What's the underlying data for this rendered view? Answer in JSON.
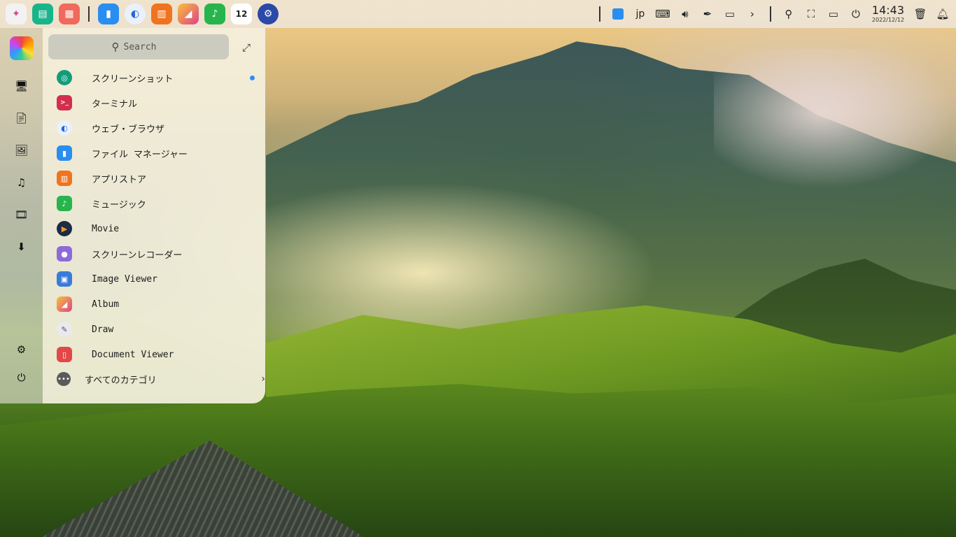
{
  "taskbar": {
    "apps": [
      {
        "name": "launcher-icon",
        "glyph": "✦",
        "color": "#f2f2f2"
      },
      {
        "name": "multitasking-icon",
        "glyph": "▤",
        "color": "#19b58a"
      },
      {
        "name": "app-grid-icon",
        "glyph": "▦",
        "color": "#f06a5b"
      },
      {
        "name": "file-manager-icon",
        "glyph": "▮",
        "color": "#2a8df0"
      },
      {
        "name": "browser-icon",
        "glyph": "◐",
        "color": "#2566d8"
      },
      {
        "name": "app-store-icon",
        "glyph": "▥",
        "color": "#f0731f"
      },
      {
        "name": "album-icon",
        "glyph": "◢",
        "color": "#f0a02e"
      },
      {
        "name": "music-icon",
        "glyph": "♪",
        "color": "#27b44c"
      },
      {
        "name": "calendar-icon",
        "glyph": "12",
        "color": "#ffffff"
      },
      {
        "name": "settings-icon",
        "glyph": "⚙",
        "color": "#2a49a8"
      }
    ],
    "tray": {
      "input_method": "jp",
      "icons": [
        "screenshot-tray-icon",
        "keyboard-icon",
        "volume-icon",
        "pen-icon",
        "battery-icon",
        "expand-arrow-icon",
        "search-icon",
        "screen-capture-icon",
        "display-icon",
        "power-icon"
      ]
    },
    "clock": {
      "time": "14:43",
      "date": "2022/12/12"
    }
  },
  "launcher": {
    "search": {
      "placeholder": "Search"
    },
    "apps": [
      {
        "label": "スクリーンショット",
        "icon": "screenshot-icon",
        "color": "#139c7a",
        "glyph": "◎",
        "new": true
      },
      {
        "label": "ターミナル",
        "icon": "terminal-icon",
        "color": "#d32f4c",
        "glyph": ">_"
      },
      {
        "label": "ウェブ・ブラウザ",
        "icon": "browser-icon",
        "color": "#2566d8",
        "glyph": "◐"
      },
      {
        "label": "ファイル マネージャー",
        "icon": "file-manager-icon",
        "color": "#2a8df0",
        "glyph": "▮"
      },
      {
        "label": "アプリストア",
        "icon": "app-store-icon",
        "color": "#f0731f",
        "glyph": "▥"
      },
      {
        "label": "ミュージック",
        "icon": "music-icon",
        "color": "#27b44c",
        "glyph": "♪"
      },
      {
        "label": "Movie",
        "icon": "movie-icon",
        "color": "#1d2b44",
        "glyph": "▶"
      },
      {
        "label": "スクリーンレコーダー",
        "icon": "screen-recorder-icon",
        "color": "#8d6ad8",
        "glyph": "●"
      },
      {
        "label": "Image Viewer",
        "icon": "image-viewer-icon",
        "color": "#3a7bd8",
        "glyph": "▣"
      },
      {
        "label": "Album",
        "icon": "album-icon",
        "color": "#f0a02e",
        "glyph": "◢"
      },
      {
        "label": "Draw",
        "icon": "draw-icon",
        "color": "#e9e9ef",
        "glyph": "✎"
      },
      {
        "label": "Document Viewer",
        "icon": "document-viewer-icon",
        "color": "#e24848",
        "glyph": "▯"
      }
    ],
    "all_categories": "すべてのカテゴリ",
    "sidebar": [
      "computer-icon",
      "document-icon",
      "picture-icon",
      "music-note-icon",
      "video-icon",
      "download-icon"
    ]
  }
}
